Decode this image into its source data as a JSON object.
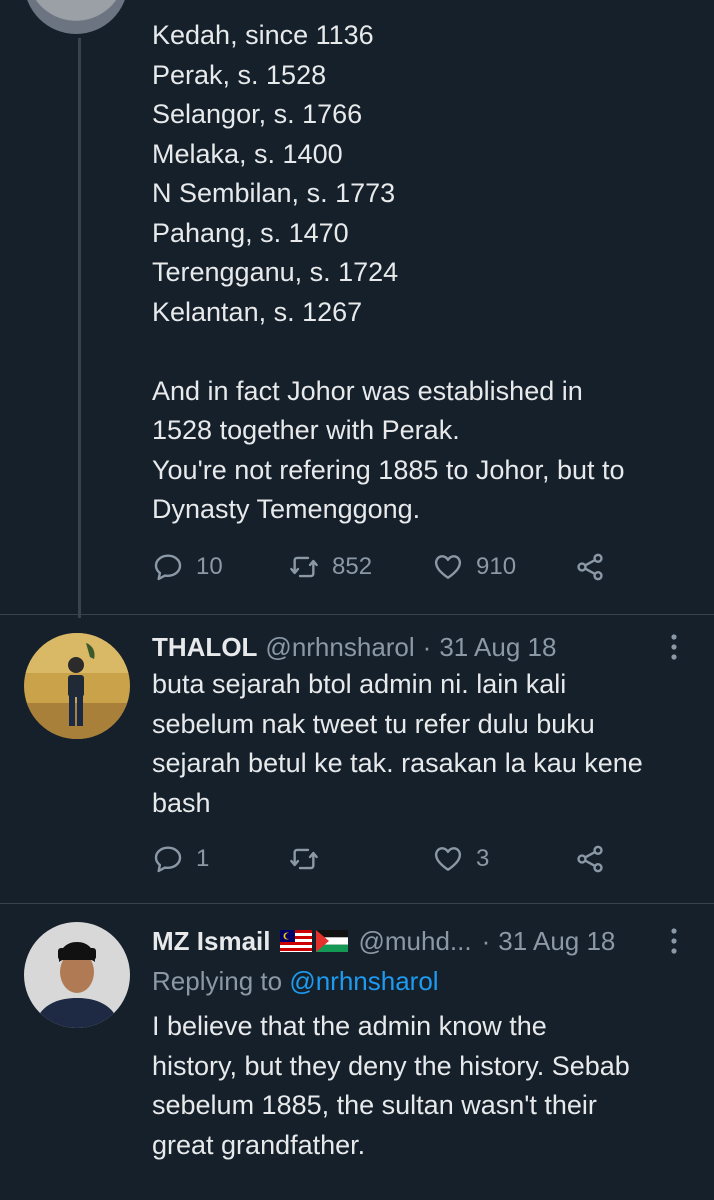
{
  "tweet1": {
    "lines": [
      "Kedah, since 1136",
      "Perak, s. 1528",
      "Selangor, s. 1766",
      "Melaka, s. 1400",
      "N Sembilan, s. 1773",
      "Pahang, s. 1470",
      "Terengganu, s. 1724",
      "Kelantan, s. 1267",
      "",
      "And in fact Johor was established in",
      "1528 together with Perak.",
      "You're not refering 1885 to Johor, but to",
      "Dynasty Temenggong."
    ],
    "replies": "10",
    "retweets": "852",
    "likes": "910"
  },
  "tweet2": {
    "name": "THALOL",
    "handle": "@nrhnsharol",
    "dot": "·",
    "date": "31 Aug 18",
    "lines": [
      "buta sejarah btol admin ni. lain kali",
      "sebelum nak tweet tu refer dulu buku",
      "sejarah betul ke tak. rasakan la kau kene",
      "bash"
    ],
    "replies": "1",
    "retweets": "",
    "likes": "3"
  },
  "tweet3": {
    "name": "MZ Ismail",
    "handle": "@muhd...",
    "dot": "·",
    "date": "31 Aug 18",
    "replying_prefix": "Replying to",
    "replying_mention": "@nrhnsharol",
    "lines": [
      "I believe that the admin know the",
      "history, but they deny the history. Sebab",
      "sebelum 1885, the sultan wasn't their",
      "great grandfather."
    ]
  },
  "icons": {
    "reply": "reply-icon",
    "retweet": "retweet-icon",
    "like": "heart-icon",
    "share": "share-icon",
    "more": "more-vertical-icon",
    "flag_malaysia": "malaysia-flag-icon",
    "flag_palestine": "palestine-flag-icon"
  },
  "colors": {
    "background": "#15202b",
    "text": "#e7e9ea",
    "muted": "#8b98a5",
    "link": "#1d9bf0",
    "divider": "#38444d"
  }
}
